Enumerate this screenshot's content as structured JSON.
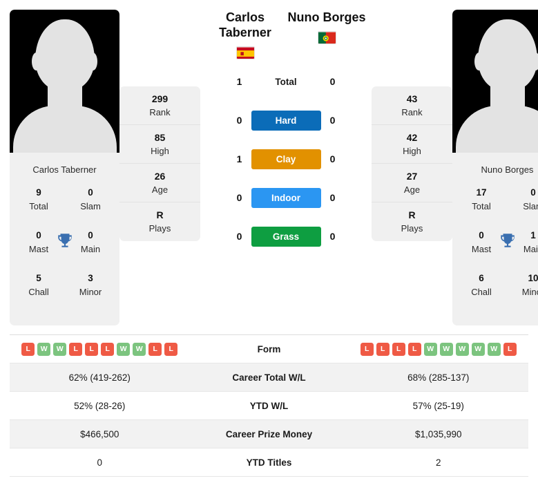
{
  "players": {
    "left": {
      "name": "Carlos Taberner",
      "name_line1": "Carlos",
      "name_line2": "Taberner",
      "flag": "spain-flag",
      "rank": "299",
      "rank_label": "Rank",
      "high": "85",
      "high_label": "High",
      "age": "26",
      "age_label": "Age",
      "plays": "R",
      "plays_label": "Plays",
      "titles": {
        "total": "9",
        "total_label": "Total",
        "slam": "0",
        "slam_label": "Slam",
        "mast": "0",
        "mast_label": "Mast",
        "main": "0",
        "main_label": "Main",
        "chall": "5",
        "chall_label": "Chall",
        "minor": "3",
        "minor_label": "Minor"
      },
      "form": [
        "L",
        "W",
        "W",
        "L",
        "L",
        "L",
        "W",
        "W",
        "L",
        "L"
      ]
    },
    "right": {
      "name": "Nuno Borges",
      "name_line1": "Nuno Borges",
      "name_line2": "",
      "flag": "portugal-flag",
      "rank": "43",
      "rank_label": "Rank",
      "high": "42",
      "high_label": "High",
      "age": "27",
      "age_label": "Age",
      "plays": "R",
      "plays_label": "Plays",
      "titles": {
        "total": "17",
        "total_label": "Total",
        "slam": "0",
        "slam_label": "Slam",
        "mast": "0",
        "mast_label": "Mast",
        "main": "1",
        "main_label": "Main",
        "chall": "6",
        "chall_label": "Chall",
        "minor": "10",
        "minor_label": "Minor"
      },
      "form": [
        "L",
        "L",
        "L",
        "L",
        "W",
        "W",
        "W",
        "W",
        "W",
        "L"
      ]
    }
  },
  "head_to_head": [
    {
      "label": "Total",
      "left": "1",
      "right": "0",
      "color": "",
      "pill": false
    },
    {
      "label": "Hard",
      "left": "0",
      "right": "0",
      "color": "#0b6cb8",
      "pill": true
    },
    {
      "label": "Clay",
      "left": "1",
      "right": "0",
      "color": "#e29100",
      "pill": true
    },
    {
      "label": "Indoor",
      "left": "0",
      "right": "0",
      "color": "#2b96f2",
      "pill": true
    },
    {
      "label": "Grass",
      "left": "0",
      "right": "0",
      "color": "#0e9e41",
      "pill": true
    }
  ],
  "table": {
    "rows": [
      {
        "label": "Form",
        "left": "",
        "right": "",
        "type": "form"
      },
      {
        "label": "Career Total W/L",
        "left": "62% (419-262)",
        "right": "68% (285-137)",
        "type": "text"
      },
      {
        "label": "YTD W/L",
        "left": "52% (28-26)",
        "right": "57% (25-19)",
        "type": "text"
      },
      {
        "label": "Career Prize Money",
        "left": "$466,500",
        "right": "$1,035,990",
        "type": "text"
      },
      {
        "label": "YTD Titles",
        "left": "0",
        "right": "2",
        "type": "text"
      }
    ]
  },
  "colors": {
    "hard": "#0b6cb8",
    "clay": "#e29100",
    "indoor": "#2b96f2",
    "grass": "#0e9e41",
    "win_badge": "#7cc47f",
    "loss_badge": "#ef5a45",
    "trophy": "#3a6fb0",
    "panel": "#f0f0f0"
  }
}
